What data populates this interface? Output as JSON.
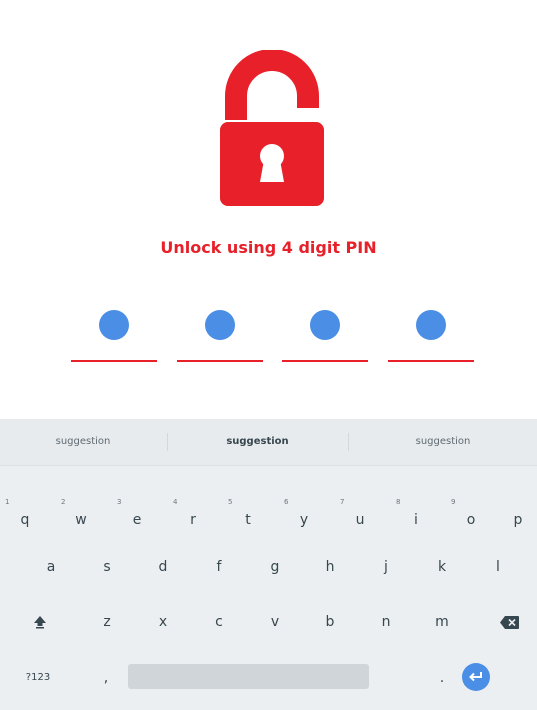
{
  "pin_screen": {
    "prompt": "Unlock using 4 digit PIN",
    "lock_icon": "lock-open-icon",
    "pin_slots": 4,
    "pin_filled": 4,
    "colors": {
      "accent": "#e8202a",
      "dot": "#4a8ee6"
    }
  },
  "keyboard": {
    "suggestions": [
      "suggestion",
      "suggestion",
      "suggestion"
    ],
    "row1": [
      {
        "key": "q",
        "hint": "1"
      },
      {
        "key": "w",
        "hint": "2"
      },
      {
        "key": "e",
        "hint": "3"
      },
      {
        "key": "r",
        "hint": "4"
      },
      {
        "key": "t",
        "hint": "5"
      },
      {
        "key": "y",
        "hint": "6"
      },
      {
        "key": "u",
        "hint": "7"
      },
      {
        "key": "i",
        "hint": "8"
      },
      {
        "key": "o",
        "hint": "9"
      },
      {
        "key": "p",
        "hint": ""
      }
    ],
    "row2": [
      "a",
      "s",
      "d",
      "f",
      "g",
      "h",
      "j",
      "k",
      "l"
    ],
    "row3": [
      "z",
      "x",
      "c",
      "v",
      "b",
      "n",
      "m"
    ],
    "row4": {
      "symbols": "?123",
      "comma": ",",
      "period": "."
    },
    "icons": {
      "shift": "shift-icon",
      "backspace": "backspace-icon",
      "enter": "enter-icon"
    }
  }
}
